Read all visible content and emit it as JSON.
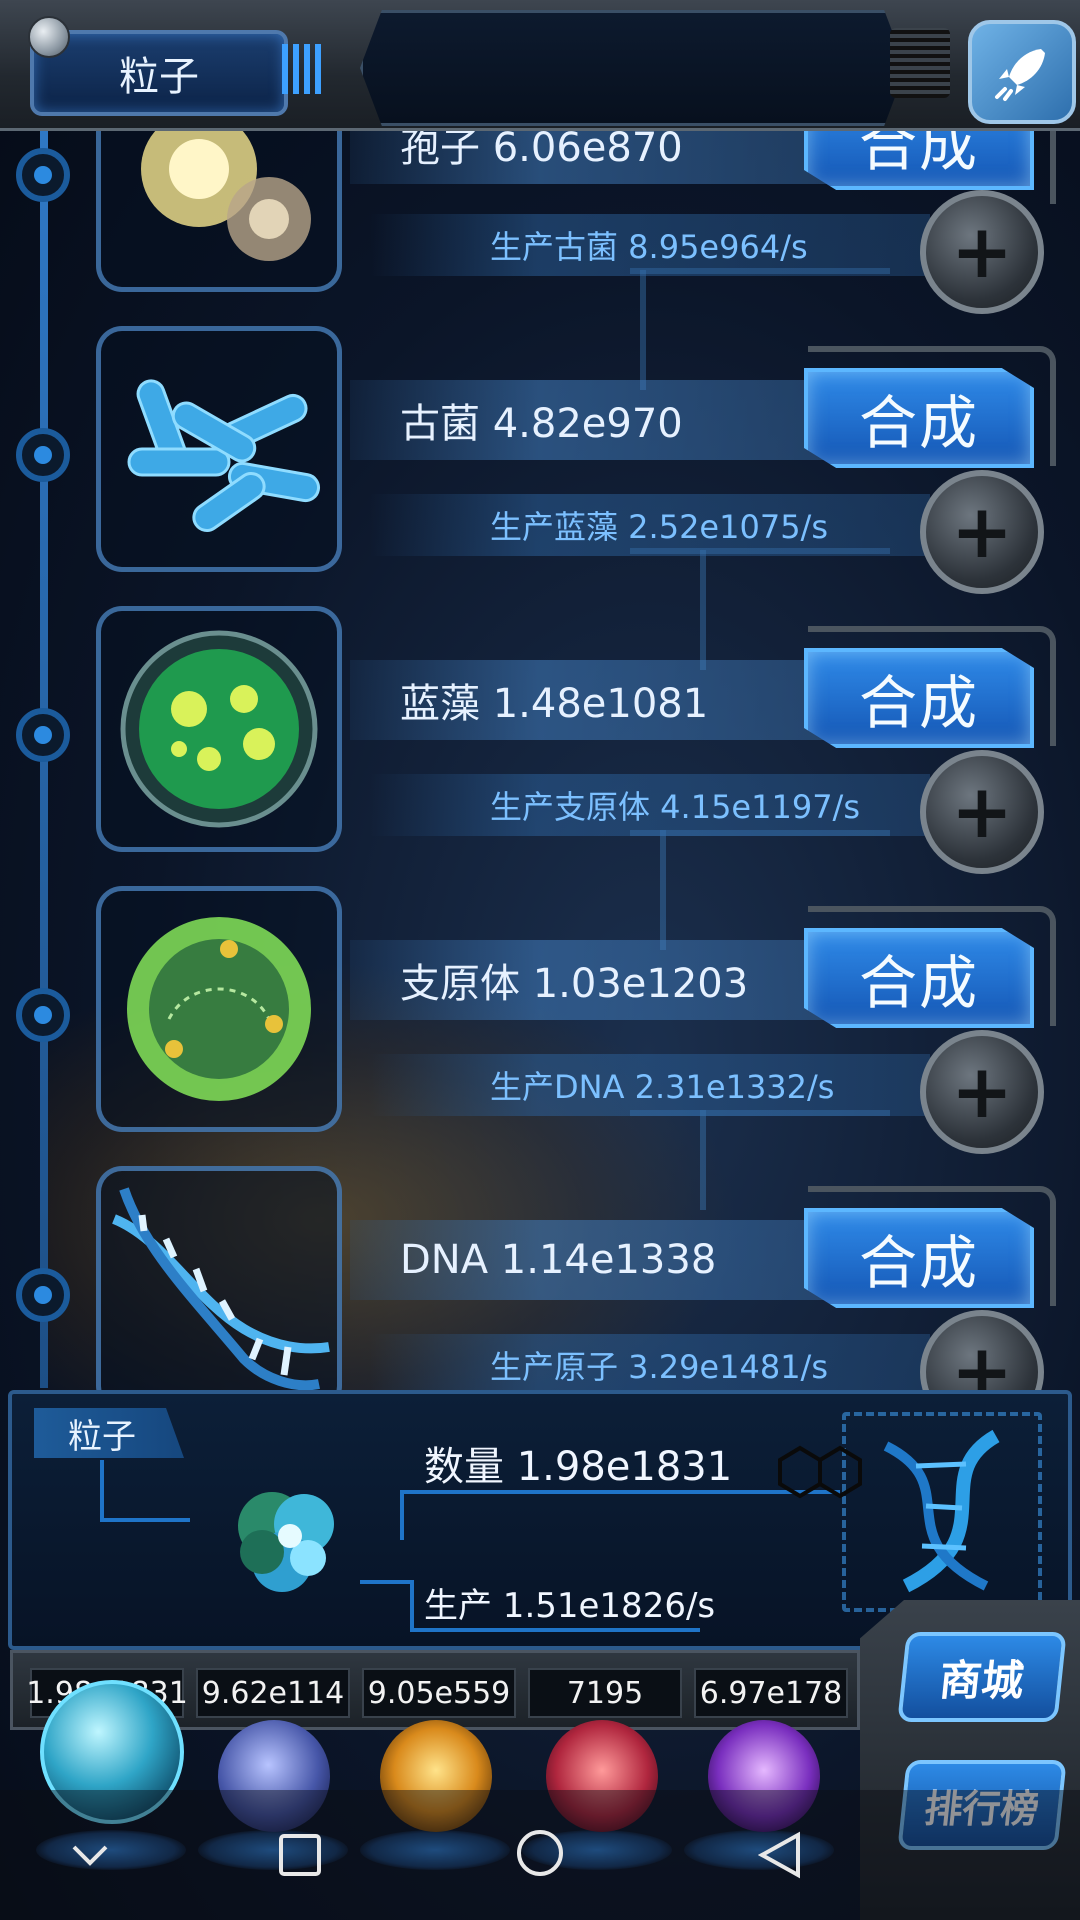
{
  "header": {
    "title": "粒子"
  },
  "rows": [
    {
      "name": "孢子 6.06e870",
      "production": "生产古菌 8.95e964/s",
      "button": "合成",
      "plus": "+"
    },
    {
      "name": "古菌 4.82e970",
      "production": "生产蓝藻 2.52e1075/s",
      "button": "合成",
      "plus": "+"
    },
    {
      "name": "蓝藻 1.48e1081",
      "production": "生产支原体 4.15e1197/s",
      "button": "合成",
      "plus": "+"
    },
    {
      "name": "支原体 1.03e1203",
      "production": "生产DNA 2.31e1332/s",
      "button": "合成",
      "plus": "+"
    },
    {
      "name": "DNA 1.14e1338",
      "production": "生产原子 3.29e1481/s",
      "button": "合成",
      "plus": "+"
    }
  ],
  "panel": {
    "tab_label": "粒子",
    "quantity": "数量 1.98e1831",
    "production": "生产 1.51e1826/s"
  },
  "resources": [
    "1.98e1831",
    "9.62e114",
    "9.05e559",
    "7195",
    "6.97e178"
  ],
  "side_buttons": {
    "shop": "商城",
    "ranking": "排行榜"
  },
  "colors": {
    "accent": "#2f8ae8",
    "panel": "#0c1f38",
    "text_blue": "#7cc0ff"
  }
}
